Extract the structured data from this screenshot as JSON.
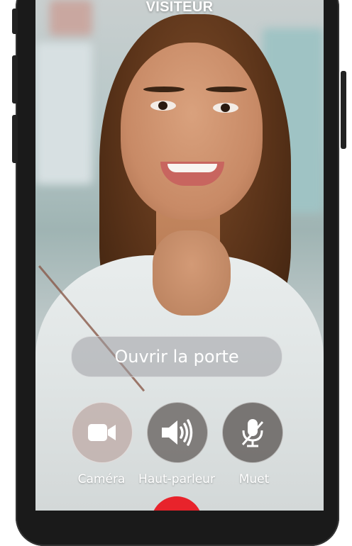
{
  "header": {
    "title": "VISITEUR"
  },
  "actions": {
    "open_door_label": "Ouvrir la porte"
  },
  "controls": [
    {
      "label": "Caméra",
      "icon": "video-camera-icon"
    },
    {
      "label": "Haut-parleur",
      "icon": "speaker-icon"
    },
    {
      "label": "Muet",
      "icon": "microphone-off-icon"
    }
  ],
  "colors": {
    "hangup": "#e8232b",
    "text": "#ffffff"
  }
}
